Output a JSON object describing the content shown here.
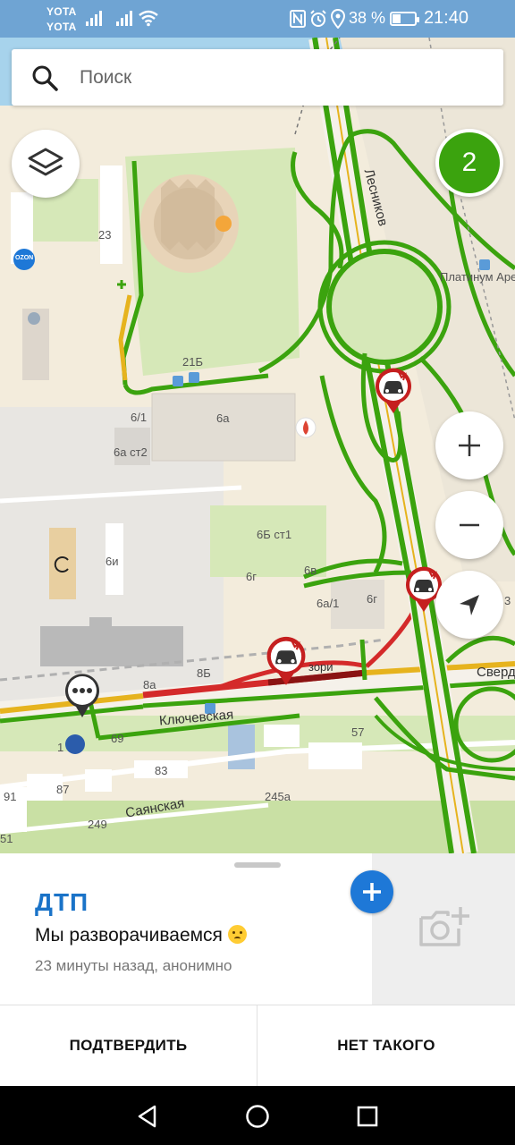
{
  "status_bar": {
    "carrier1": "YOTA",
    "carrier2": "YOTA",
    "battery_percent": "38 %",
    "battery_level": 0.38,
    "time": "21:40",
    "icons": [
      "signal-icon",
      "wifi-icon",
      "nfc-icon",
      "alarm-icon",
      "location-icon",
      "battery-icon"
    ]
  },
  "search": {
    "placeholder": "Поиск"
  },
  "map": {
    "traffic_score": "2",
    "labels": {
      "street_lesnikov": "Лесников",
      "place_platinum": "Платинум Аре",
      "house_23": "23",
      "house_21b": "21Б",
      "house_6_1": "6/1",
      "house_6a": "6а",
      "house_6a_st2": "6а ст2",
      "house_6b_st1": "6Б ст1",
      "house_6i": "6и",
      "house_6g_1": "6г",
      "house_6v": "6в",
      "house_6a_1": "6а/1",
      "house_6g_2": "6г",
      "house_8b": "8Б",
      "house_8a": "8а",
      "street_klyuchevskaya": "Ключевская",
      "street_sverd": "Сверд",
      "zori": "зори",
      "house_69": "69",
      "house_57": "57",
      "house_83": "83",
      "house_87": "87",
      "house_91": "91",
      "house_249": "249",
      "house_245a": "245а",
      "house_51": "51",
      "house_1": "1",
      "house_3": "3",
      "street_sayanskaya": "Саянская",
      "ozon": "OZON"
    }
  },
  "event": {
    "title": "ДТП",
    "message": "Мы разворачиваемся",
    "meta": "23 минуты назад, анонимно"
  },
  "actions": {
    "confirm": "ПОДТВЕРДИТЬ",
    "deny": "НЕТ ТАКОГО"
  },
  "colors": {
    "traffic_green": "#3ba30e",
    "traffic_red": "#d42a2a",
    "traffic_yellow": "#e6b31e",
    "accent_blue": "#1a73c8",
    "status_bar": "#6fa4d3"
  }
}
